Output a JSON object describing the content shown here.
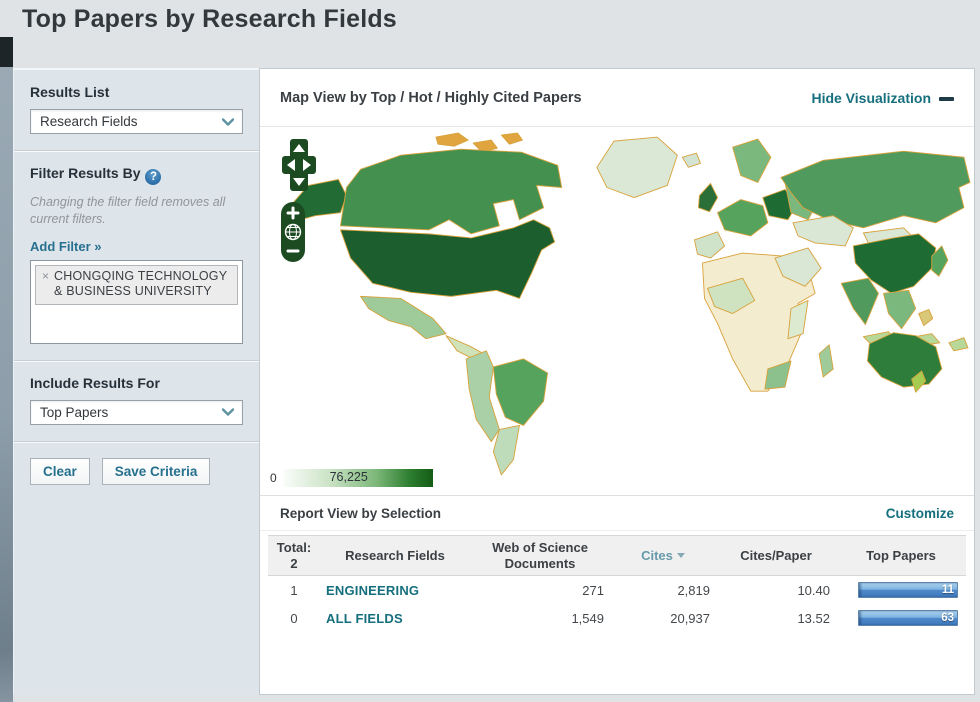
{
  "page": {
    "title": "Top Papers by Research Fields"
  },
  "sidebar": {
    "results_list": {
      "label": "Results List",
      "selected": "Research Fields"
    },
    "filter": {
      "heading": "Filter Results By",
      "help_glyph": "?",
      "note": "Changing the filter field removes all current filters.",
      "add_filter_label": "Add Filter »",
      "tags": [
        {
          "remove_glyph": "×",
          "label": "CHONGQING TECHNOLOGY & BUSINESS UNIVERSITY"
        }
      ]
    },
    "include_results": {
      "label": "Include Results For",
      "selected": "Top Papers"
    },
    "buttons": {
      "clear": "Clear",
      "save": "Save Criteria"
    }
  },
  "map_view": {
    "title": "Map View by Top / Hot / Highly Cited Papers",
    "hide_label": "Hide Visualization",
    "legend": {
      "min": "0",
      "max": "76,225"
    },
    "colors": {
      "ocean": "#ffffff",
      "land_default": "#f4edd2",
      "alaska": "#236b35",
      "canada": "#44904f",
      "greenland": "#dae8d5",
      "usa": "#1c5e2e",
      "mexico": "#9fca9a",
      "central_america": "#cfe2b8",
      "sa_west": "#a9d0a6",
      "brazil": "#55a35c",
      "argentina": "#bfdcba",
      "iceland": "#d3e3d2",
      "uk": "#2a6e38",
      "scandinavia": "#7ab87e",
      "west_europe": "#55a35c",
      "iberia": "#cfe3cb",
      "central_europe": "#1e6b33",
      "east_europe": "#7ab87e",
      "africa": "#f3eccf",
      "west_africa": "#cfe3c0",
      "east_africa": "#dcead0",
      "south_africa": "#8cc08c",
      "madagascar": "#9fca9a",
      "russia": "#4f9a5c",
      "kazakhstan": "#d9e7d4",
      "middle_east": "#d9e7d4",
      "mongolia": "#d9e7d4",
      "china": "#1e6b33",
      "india": "#4f9a5c",
      "se_asia": "#7ab87e",
      "indonesia": "#b8d89a",
      "japan": "#55a35c",
      "philippines": "#d8c878",
      "australia": "#2e7d3a",
      "new_zealand": "#a5cc50",
      "arctic_islands": "#e0a53f"
    }
  },
  "report": {
    "title": "Report View by Selection",
    "customize_label": "Customize",
    "table": {
      "headers": {
        "total_label": "Total:",
        "total_count": "2",
        "field": "Research Fields",
        "docs_line1": "Web of Science",
        "docs_line2": "Documents",
        "cites": "Cites",
        "cites_per_paper": "Cites/Paper",
        "top_papers": "Top Papers"
      },
      "rows": [
        {
          "rank": "1",
          "field": "ENGINEERING",
          "docs": "271",
          "cites": "2,819",
          "cites_per_paper": "10.40",
          "top_papers": "11"
        },
        {
          "rank": "0",
          "field": "ALL FIELDS",
          "docs": "1,549",
          "cites": "20,937",
          "cites_per_paper": "13.52",
          "top_papers": "63"
        }
      ]
    }
  }
}
